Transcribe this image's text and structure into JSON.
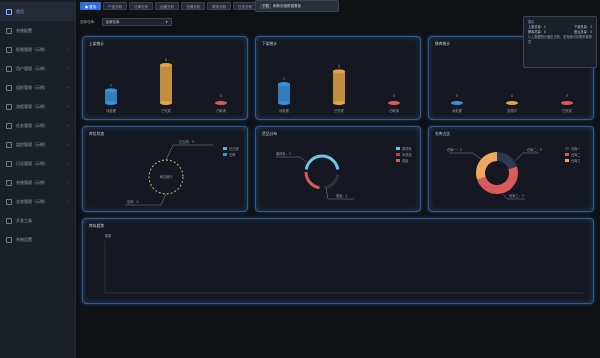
{
  "sidebar": {
    "items": [
      {
        "label": "首页",
        "active": true
      },
      {
        "label": "系统配置",
        "active": false
      },
      {
        "label": "权限管理（示例）",
        "active": false
      },
      {
        "label": "用户管理（示例）",
        "active": false
      },
      {
        "label": "组织管理（示例）",
        "active": false
      },
      {
        "label": "流程管理（示例）",
        "active": false
      },
      {
        "label": "任务管理（示例）",
        "active": false
      },
      {
        "label": "监控管理（示例）",
        "active": false
      },
      {
        "label": "日志管理（示例）",
        "active": false
      },
      {
        "label": "系统管理（示例）",
        "active": false
      },
      {
        "label": "业务管理（示例）",
        "active": false
      },
      {
        "label": "开发工具",
        "active": false
      },
      {
        "label": "系统设置",
        "active": false
      }
    ]
  },
  "tabs": [
    {
      "label": "● 首页",
      "active": true
    },
    {
      "label": "产品分析",
      "active": false
    },
    {
      "label": "订单分析",
      "active": false
    },
    {
      "label": "运营分析",
      "active": false
    },
    {
      "label": "仓储分析",
      "active": false
    },
    {
      "label": "财务分析",
      "active": false
    },
    {
      "label": "日志分析",
      "active": false
    }
  ],
  "toolbar": {
    "pill": "下载",
    "text": "刷新页面数据看板"
  },
  "filter": {
    "label": "选择仓库：",
    "value": "全部仓库"
  },
  "info_pop": {
    "title": "提示",
    "rows": [
      [
        "上架总量：2",
        "下架总量：3"
      ],
      [
        "移库总量：0",
        "盘点总量：0"
      ]
    ],
    "note": "以上数据统计截至当前，如有疑问请联系管理员"
  },
  "panels": {
    "p1": {
      "title": "上架统计",
      "bars": [
        {
          "label": "待处理",
          "value": 2,
          "color": "#3a8fd6"
        },
        {
          "label": "已完成",
          "value": 6,
          "color": "#e0a246"
        },
        {
          "label": "已取消",
          "value": 0,
          "color": "#d95a5a"
        }
      ]
    },
    "p2": {
      "title": "下架统计",
      "bars": [
        {
          "label": "待处理",
          "value": 3,
          "color": "#3a8fd6"
        },
        {
          "label": "已完成",
          "value": 5,
          "color": "#e0a246"
        },
        {
          "label": "已取消",
          "value": 0,
          "color": "#d95a5a"
        }
      ]
    },
    "p3": {
      "title": "移库统计",
      "bars": [
        {
          "label": "待处理",
          "value": 0,
          "color": "#3a8fd6"
        },
        {
          "label": "处理中",
          "value": 0,
          "color": "#e0a246"
        },
        {
          "label": "已完成",
          "value": 0,
          "color": "#d95a5a"
        }
      ]
    },
    "p4": {
      "title": "库位状态",
      "center": "库位统计",
      "legend": [
        {
          "name": "已占用",
          "color": "#4fc3b5"
        },
        {
          "name": "空闲",
          "color": "#3a8fd6"
        }
      ],
      "callouts": [
        "已占用：3",
        "空闲：0"
      ]
    },
    "p5": {
      "title": "货品分布",
      "legend": [
        {
          "name": "原材料",
          "color": "#6ec6e8"
        },
        {
          "name": "半成品",
          "color": "#b04848"
        },
        {
          "name": "成品",
          "color": "#d95a5a"
        }
      ],
      "callouts": [
        "原材料：3",
        "成品：2"
      ]
    },
    "p6": {
      "title": "仓库占比",
      "legend": [
        {
          "name": "仓库一",
          "color": "#2f3a52"
        },
        {
          "name": "仓库二",
          "color": "#d95a5a"
        },
        {
          "name": "仓库三",
          "color": "#f0a860"
        }
      ],
      "callouts": [
        "仓库一：2",
        "仓库二：5",
        "仓库三：3"
      ]
    },
    "p7": {
      "title": "库存趋势",
      "ylabel": "数量"
    }
  }
}
